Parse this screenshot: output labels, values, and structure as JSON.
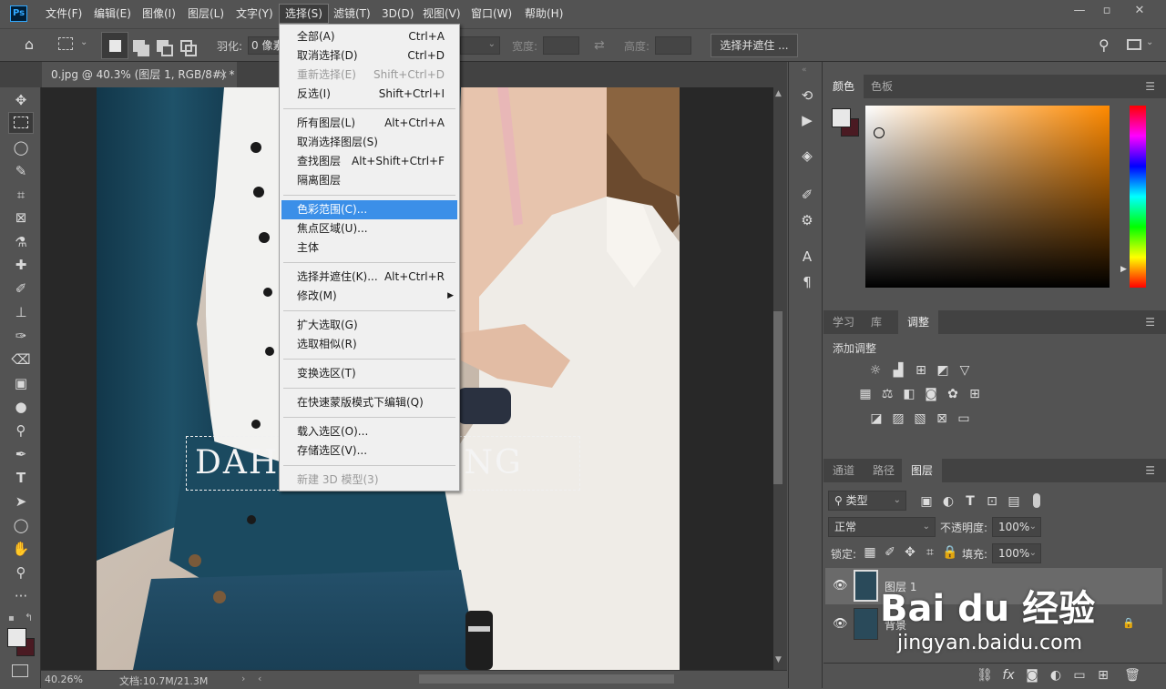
{
  "app": {
    "logo": "Ps"
  },
  "menubar": {
    "items": [
      "文件(F)",
      "编辑(E)",
      "图像(I)",
      "图层(L)",
      "文字(Y)",
      "选择(S)",
      "滤镜(T)",
      "3D(D)",
      "视图(V)",
      "窗口(W)",
      "帮助(H)"
    ],
    "active": "选择(S)",
    "window_buttons": {
      "minimize": "—",
      "restore": "▫",
      "close": "✕"
    }
  },
  "options": {
    "feather_label": "羽化:",
    "feather_value": "0 像素",
    "width_label": "宽度:",
    "height_label": "高度:",
    "select_mask_button": "选择并遮住 ..."
  },
  "document": {
    "tab_title": "0.jpg @ 40.3% (图层 1, RGB/8#) *",
    "close": "×",
    "watermark_text": "DAHUA   HEYING"
  },
  "status": {
    "zoom": "40.26%",
    "doc_info": "文档:10.7M/21.3M"
  },
  "select_menu": {
    "items": [
      {
        "label": "全部(A)",
        "shortcut": "Ctrl+A",
        "state": "normal"
      },
      {
        "label": "取消选择(D)",
        "shortcut": "Ctrl+D",
        "state": "normal"
      },
      {
        "label": "重新选择(E)",
        "shortcut": "Shift+Ctrl+D",
        "state": "disabled"
      },
      {
        "label": "反选(I)",
        "shortcut": "Shift+Ctrl+I",
        "state": "normal"
      },
      {
        "label": "所有图层(L)",
        "shortcut": "Alt+Ctrl+A",
        "state": "normal"
      },
      {
        "label": "取消选择图层(S)",
        "shortcut": "",
        "state": "normal"
      },
      {
        "label": "查找图层",
        "shortcut": "Alt+Shift+Ctrl+F",
        "state": "normal"
      },
      {
        "label": "隔离图层",
        "shortcut": "",
        "state": "normal"
      },
      {
        "label": "色彩范围(C)...",
        "shortcut": "",
        "state": "highlighted"
      },
      {
        "label": "焦点区域(U)...",
        "shortcut": "",
        "state": "normal"
      },
      {
        "label": "主体",
        "shortcut": "",
        "state": "normal"
      },
      {
        "label": "选择并遮住(K)...",
        "shortcut": "Alt+Ctrl+R",
        "state": "normal"
      },
      {
        "label": "修改(M)",
        "shortcut": "",
        "state": "submenu"
      },
      {
        "label": "扩大选取(G)",
        "shortcut": "",
        "state": "normal"
      },
      {
        "label": "选取相似(R)",
        "shortcut": "",
        "state": "normal"
      },
      {
        "label": "变换选区(T)",
        "shortcut": "",
        "state": "normal"
      },
      {
        "label": "在快速蒙版模式下编辑(Q)",
        "shortcut": "",
        "state": "normal"
      },
      {
        "label": "载入选区(O)...",
        "shortcut": "",
        "state": "normal"
      },
      {
        "label": "存储选区(V)...",
        "shortcut": "",
        "state": "normal"
      },
      {
        "label": "新建 3D 模型(3)",
        "shortcut": "",
        "state": "disabled"
      }
    ]
  },
  "color_panel": {
    "tabs": [
      "颜色",
      "色板"
    ],
    "active": "颜色",
    "hue_color": "#ff8a00"
  },
  "adjust_panel": {
    "tabs": [
      "学习",
      "库",
      "调整"
    ],
    "active": "调整",
    "heading": "添加调整"
  },
  "layers_panel": {
    "tabs": [
      "通道",
      "路径",
      "图层"
    ],
    "active": "图层",
    "filter_kind": "类型",
    "blend_mode": "正常",
    "opacity_label": "不透明度:",
    "opacity_value": "100%",
    "lock_label": "锁定:",
    "fill_label": "填充:",
    "fill_value": "100%",
    "layers": [
      {
        "name": "图层 1",
        "selected": true,
        "locked": false
      },
      {
        "name": "背景",
        "selected": false,
        "locked": true
      }
    ]
  },
  "overlay_watermark": {
    "brand": "Bai du 经验",
    "url": "jingyan.baidu.com"
  }
}
